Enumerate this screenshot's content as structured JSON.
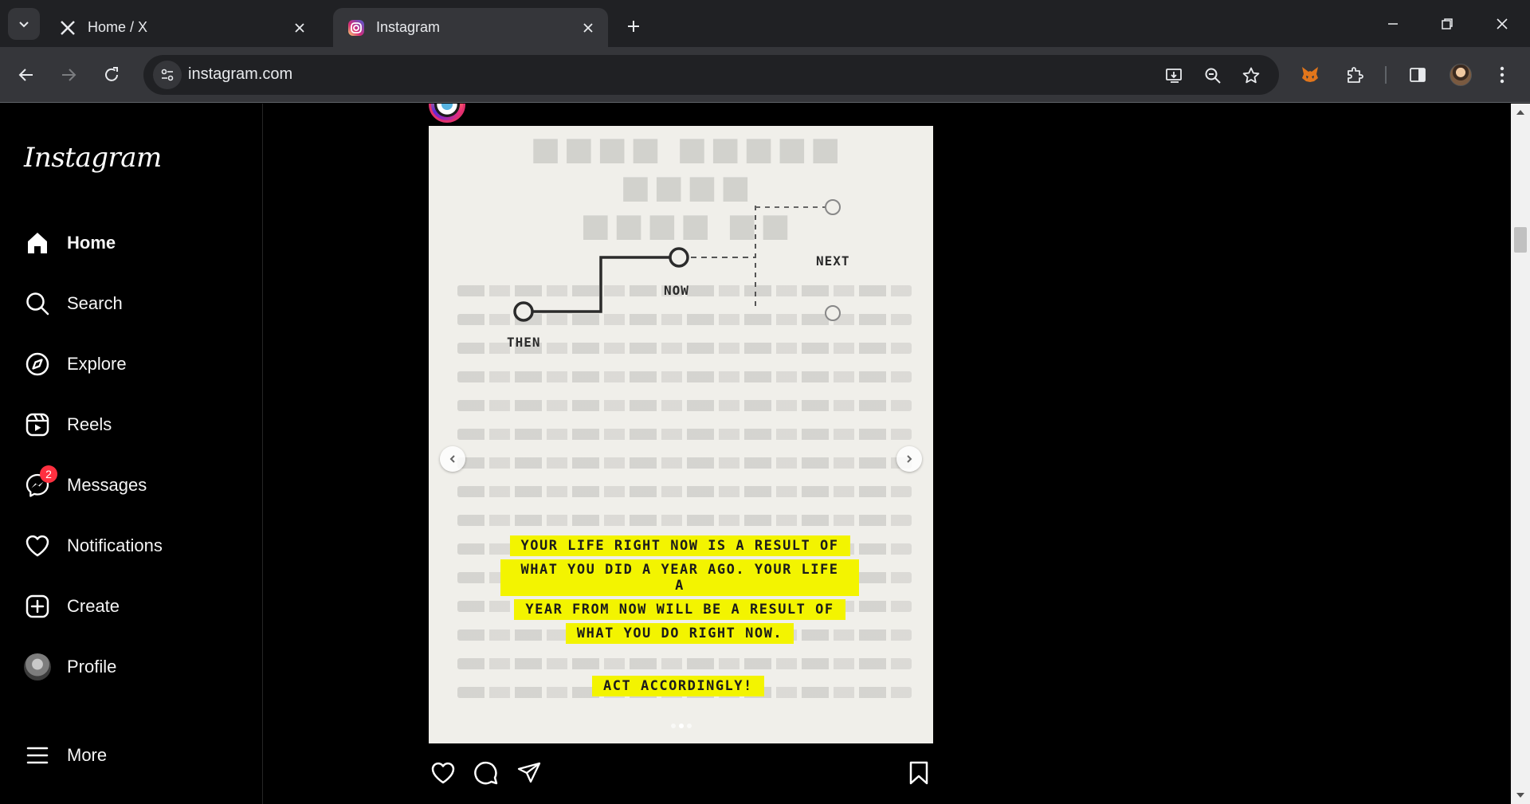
{
  "browser": {
    "tabs": [
      {
        "title": "Home / X",
        "favicon": "x-logo-icon",
        "active": false
      },
      {
        "title": "Instagram",
        "favicon": "instagram-logo-icon",
        "active": true
      }
    ],
    "url": "instagram.com"
  },
  "sidebar": {
    "logo_text": "Instagram",
    "items": [
      {
        "label": "Home",
        "icon": "home-icon"
      },
      {
        "label": "Search",
        "icon": "search-icon"
      },
      {
        "label": "Explore",
        "icon": "compass-icon"
      },
      {
        "label": "Reels",
        "icon": "reels-icon"
      },
      {
        "label": "Messages",
        "icon": "messenger-icon",
        "badge": "2"
      },
      {
        "label": "Notifications",
        "icon": "heart-icon"
      },
      {
        "label": "Create",
        "icon": "plus-square-icon"
      },
      {
        "label": "Profile",
        "icon": "avatar"
      },
      {
        "label": "More",
        "icon": "menu-icon"
      }
    ]
  },
  "post": {
    "image": {
      "diagram_labels": {
        "then": "THEN",
        "now": "NOW",
        "next": "NEXT"
      },
      "highlight_lines": [
        "YOUR LIFE RIGHT NOW IS A RESULT OF",
        "WHAT YOU DID A YEAR AGO. YOUR LIFE A",
        "YEAR FROM NOW WILL BE A RESULT OF",
        "WHAT YOU DO RIGHT NOW."
      ],
      "callout": "ACT ACCORDINGLY!"
    },
    "actions": [
      "like-icon",
      "comment-icon",
      "share-icon",
      "save-icon"
    ]
  },
  "colors": {
    "highlight": "#f3f400",
    "badge": "#ff3040",
    "chrome_dark": "#202124",
    "chrome_toolbar": "#35363a"
  }
}
